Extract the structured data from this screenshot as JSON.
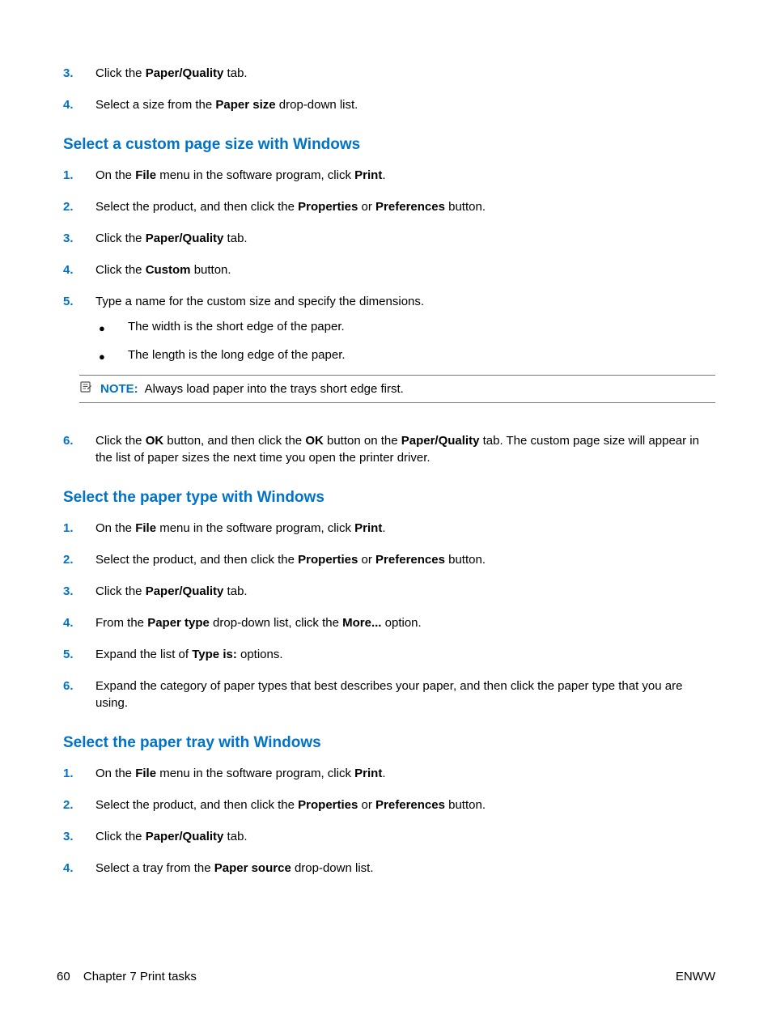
{
  "footer": {
    "page_number": "60",
    "chapter": "Chapter 7   Print tasks",
    "right": "ENWW"
  },
  "sections": [
    {
      "class": "intro-steps",
      "steps": [
        {
          "n": "3.",
          "html": "Click the <b>Paper/Quality</b> tab."
        },
        {
          "n": "4.",
          "html": "Select a size from the <b>Paper size</b> drop-down list."
        }
      ]
    },
    {
      "heading": "Select a custom page size with Windows",
      "steps": [
        {
          "n": "1.",
          "html": "On the <b>File</b> menu in the software program, click <b>Print</b>."
        },
        {
          "n": "2.",
          "html": "Select the product, and then click the <b>Properties</b> or <b>Preferences</b> button."
        },
        {
          "n": "3.",
          "html": "Click the <b>Paper/Quality</b> tab."
        },
        {
          "n": "4.",
          "html": "Click the <b>Custom</b> button."
        },
        {
          "n": "5.",
          "html": "Type a name for the custom size and specify the dimensions.",
          "bullets": [
            "The width is the short edge of the paper.",
            "The length is the long edge of the paper."
          ],
          "note": {
            "label": "NOTE:",
            "text": "Always load paper into the trays short edge first."
          }
        },
        {
          "n": "6.",
          "html": "Click the <b>OK</b> button, and then click the <b>OK</b> button on the <b>Paper/Quality</b> tab. The custom page size will appear in the list of paper sizes the next time you open the printer driver."
        }
      ]
    },
    {
      "heading": "Select the paper type with Windows",
      "steps": [
        {
          "n": "1.",
          "html": "On the <b>File</b> menu in the software program, click <b>Print</b>."
        },
        {
          "n": "2.",
          "html": "Select the product, and then click the <b>Properties</b> or <b>Preferences</b> button."
        },
        {
          "n": "3.",
          "html": "Click the <b>Paper/Quality</b> tab."
        },
        {
          "n": "4.",
          "html": "From the <b>Paper type</b> drop-down list, click the <b>More...</b> option."
        },
        {
          "n": "5.",
          "html": "Expand the list of <b>Type is:</b> options."
        },
        {
          "n": "6.",
          "html": "Expand the category of paper types that best describes your paper, and then click the paper type that you are using."
        }
      ]
    },
    {
      "heading": "Select the paper tray with Windows",
      "steps": [
        {
          "n": "1.",
          "html": "On the <b>File</b> menu in the software program, click <b>Print</b>."
        },
        {
          "n": "2.",
          "html": "Select the product, and then click the <b>Properties</b> or <b>Preferences</b> button."
        },
        {
          "n": "3.",
          "html": "Click the <b>Paper/Quality</b> tab."
        },
        {
          "n": "4.",
          "html": "Select a tray from the <b>Paper source</b> drop-down list."
        }
      ]
    }
  ]
}
